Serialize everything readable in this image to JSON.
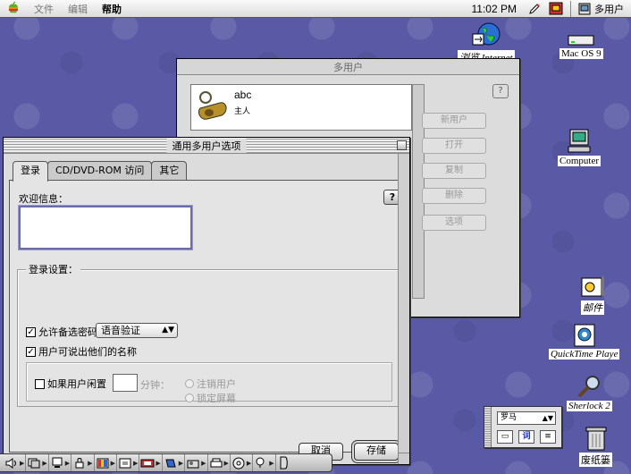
{
  "menubar": {
    "apple_icon": "apple-logo",
    "menus": [
      "文件",
      "编辑",
      "帮助"
    ],
    "active_menu": "帮助",
    "clock": "11:02 PM",
    "app_name": "多用户"
  },
  "desktop_icons": {
    "internet": "浏览 Internet",
    "macos9": "Mac OS 9",
    "computer": "Computer",
    "mail": "邮件",
    "quicktime": "QuickTime Playe",
    "sherlock": "Sherlock 2",
    "trash": "废纸篓"
  },
  "back_window": {
    "title": "多用户",
    "user": {
      "name": "abc",
      "type": "主人"
    },
    "buttons": [
      "新用户",
      "打开",
      "复制",
      "删除",
      "选项"
    ],
    "help": "?"
  },
  "front_window": {
    "title": "通用多用户选项",
    "tabs": [
      "登录",
      "CD/DVD-ROM 访问",
      "其它"
    ],
    "selected_tab": "登录",
    "welcome_label": "欢迎信息：",
    "welcome_value": "",
    "help": "?",
    "login_group_label": "登录设置：",
    "allow_alt_password": "允许备选密码",
    "alt_password_method": "语音验证",
    "users_can_speak_names": "用户可说出他们的名称",
    "if_idle": "如果用户闲置",
    "minutes": "分钟：",
    "logout_user": "注销用户",
    "lock_screen": "锁定屏幕",
    "cancel": "取消",
    "save": "存储"
  },
  "keyboard_palette": {
    "layout": "罗马",
    "btn2": "词"
  },
  "colors": {
    "desktop": "#5959a6",
    "accent": "#6b6ba8"
  }
}
